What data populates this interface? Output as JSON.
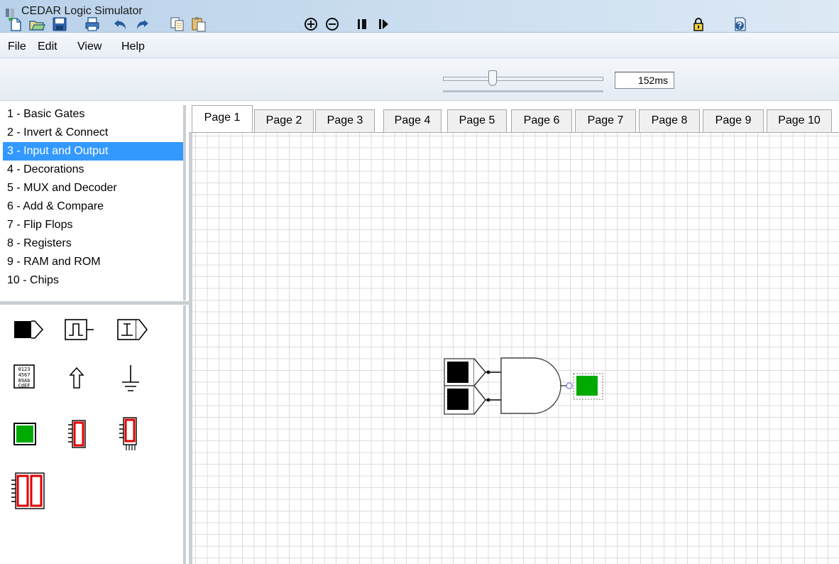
{
  "window": {
    "title": "CEDAR Logic Simulator"
  },
  "menu": {
    "file": "File",
    "edit": "Edit",
    "view": "View",
    "help": "Help"
  },
  "toolbar": {
    "icons": [
      "new-icon",
      "open-icon",
      "save-icon",
      "print-icon",
      "undo-icon",
      "redo-icon",
      "copy-icon",
      "paste-icon",
      "zoom-in-icon",
      "zoom-out-icon",
      "pause-icon",
      "step-icon",
      "lock-icon",
      "help-icon"
    ],
    "speed": "152ms",
    "speed_slider_fraction": 0.3
  },
  "palette": {
    "selected_index": 2,
    "categories": [
      "1  - Basic Gates",
      "2  - Invert & Connect",
      "3  - Input and Output",
      "4  - Decorations",
      "5  - MUX and Decoder",
      "6  - Add & Compare",
      "7  - Flip Flops",
      "8  - Registers",
      "9  - RAM and ROM",
      "10 - Chips"
    ],
    "gallery_icons": [
      "toggle-icon",
      "clock-icon",
      "pulse-icon",
      "keypad-icon",
      "pull-up-icon",
      "ground-icon",
      "led-icon",
      "seven-segment-icon",
      "seven-segment-dp-icon",
      "dual-seven-segment-icon"
    ],
    "keypad_labels": [
      "0123",
      "4567",
      "89Ab",
      "CdEF"
    ]
  },
  "tabs": [
    "Page 1",
    "Page 2",
    "Page 3",
    "Page 4",
    "Page 5",
    "Page 6",
    "Page 7",
    "Page 8",
    "Page 9",
    "Page 10"
  ],
  "active_tab": 0,
  "colors": {
    "selection": "#3399ff",
    "led_on": "#00aa00",
    "seven_segment": "#e00000",
    "grid": "#dcdcdc"
  }
}
